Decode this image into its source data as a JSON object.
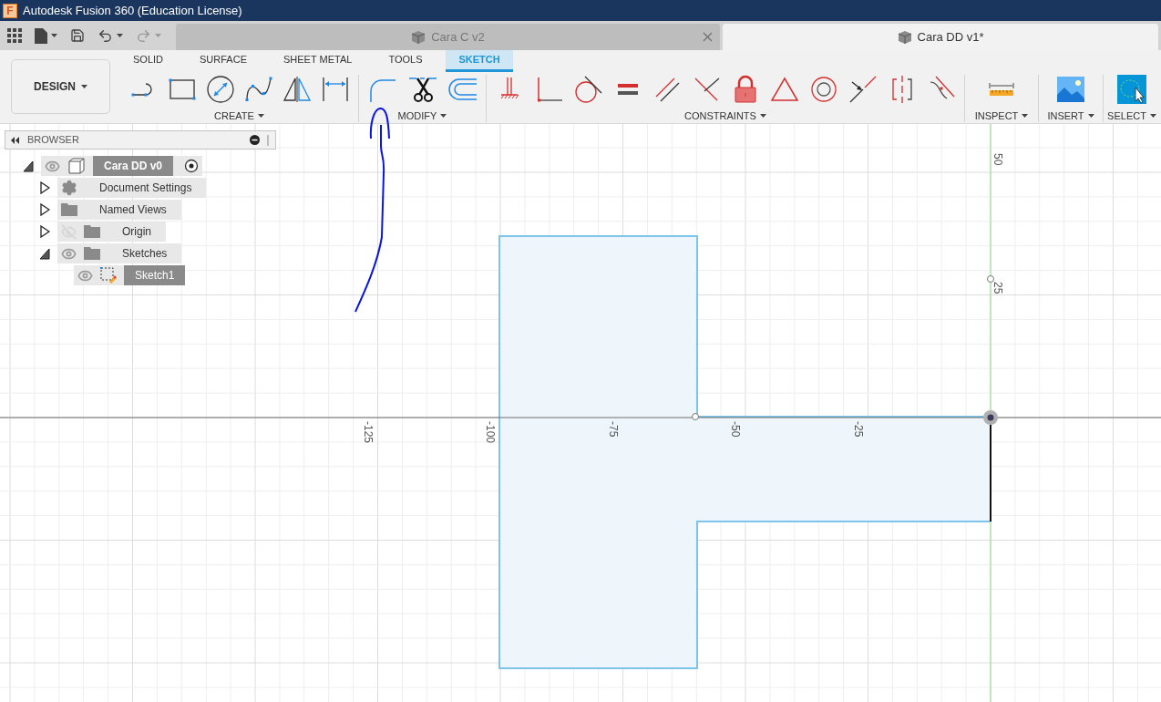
{
  "window": {
    "title": "Autodesk Fusion 360 (Education License)",
    "app_icon": "F"
  },
  "document_tabs": [
    {
      "label": "Cara C v2",
      "selected": false
    },
    {
      "label": "Cara DD v1*",
      "selected": true
    }
  ],
  "workspace": {
    "label": "DESIGN"
  },
  "toolbar_tabs": [
    {
      "label": "SOLID",
      "selected": false
    },
    {
      "label": "SURFACE",
      "selected": false
    },
    {
      "label": "SHEET METAL",
      "selected": false
    },
    {
      "label": "TOOLS",
      "selected": false
    },
    {
      "label": "SKETCH",
      "selected": true
    }
  ],
  "tool_groups": [
    {
      "label": "CREATE"
    },
    {
      "label": "MODIFY"
    },
    {
      "label": "CONSTRAINTS"
    },
    {
      "label": "INSPECT"
    },
    {
      "label": "INSERT"
    },
    {
      "label": "SELECT"
    }
  ],
  "browser": {
    "title": "BROWSER",
    "tree": [
      {
        "label": "Cara DD v0",
        "kind": "component",
        "expanded": true,
        "visible": true,
        "active": true,
        "children": [
          {
            "label": "Document Settings",
            "kind": "settings",
            "expanded": false,
            "active": false
          },
          {
            "label": "Named Views",
            "kind": "folder",
            "expanded": false,
            "active": false
          },
          {
            "label": "Origin",
            "kind": "folder",
            "expanded": false,
            "visible": false,
            "active": false
          },
          {
            "label": "Sketches",
            "kind": "folder",
            "expanded": true,
            "visible": true,
            "active": false,
            "children": [
              {
                "label": "Sketch1",
                "kind": "sketch",
                "visible": true,
                "active": true
              }
            ]
          }
        ]
      }
    ]
  },
  "canvas": {
    "x_axis_labels": [
      "-125",
      "-100",
      "-75",
      "-50",
      "-25"
    ],
    "y_axis_labels": [
      "50",
      "25"
    ]
  }
}
